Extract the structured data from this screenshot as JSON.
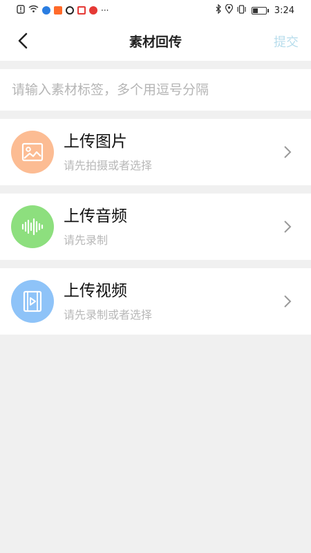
{
  "status_bar": {
    "time": "3:24",
    "more": "···"
  },
  "nav": {
    "title": "素材回传",
    "submit_label": "提交"
  },
  "tag_input": {
    "value": "",
    "placeholder": "请输入素材标签，多个用逗号分隔"
  },
  "uploads": [
    {
      "title": "上传图片",
      "subtitle": "请先拍摄或者选择",
      "icon": "image-icon",
      "color": "#fcbc93"
    },
    {
      "title": "上传音频",
      "subtitle": "请先录制",
      "icon": "audio-wave-icon",
      "color": "#8ddf7e"
    },
    {
      "title": "上传视频",
      "subtitle": "请先录制或者选择",
      "icon": "video-icon",
      "color": "#8ec3f8"
    }
  ],
  "colors": {
    "submit_disabled": "#b8ddec",
    "background": "#f0f0f0"
  }
}
